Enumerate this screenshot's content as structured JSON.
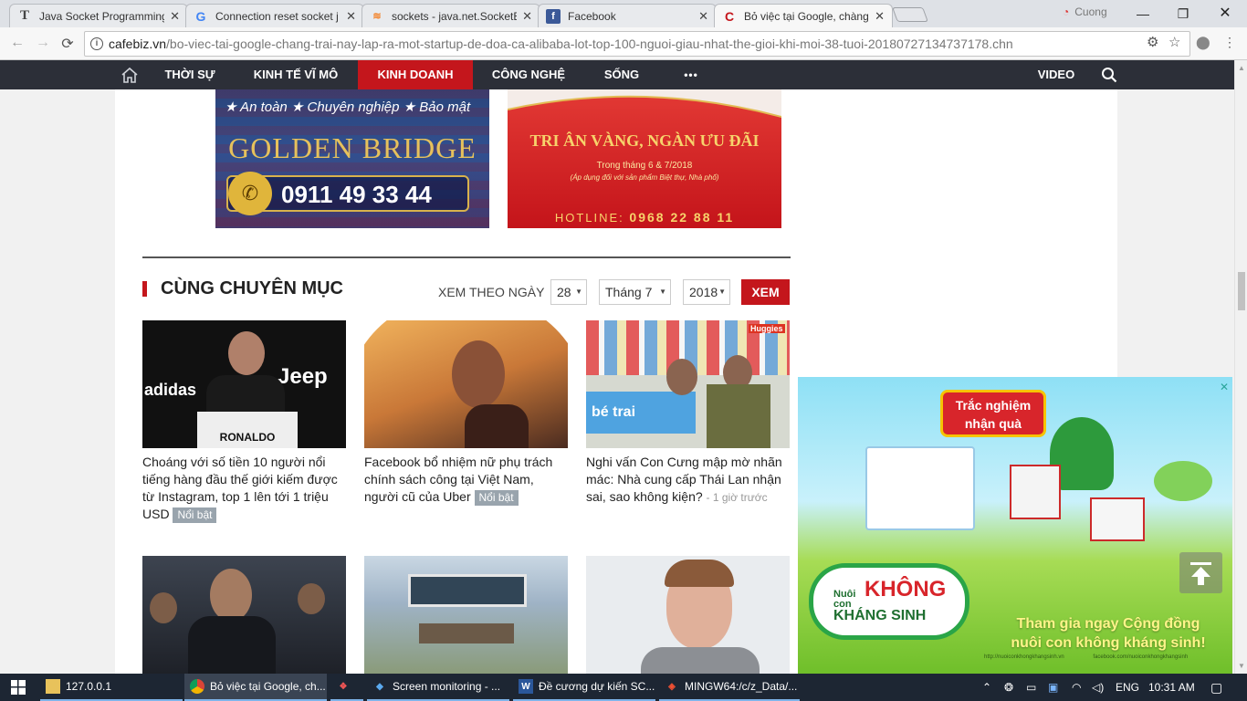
{
  "browser": {
    "tabs": [
      {
        "title": "Java Socket Programming",
        "icon": "text-T-icon"
      },
      {
        "title": "Connection reset socket j",
        "icon": "google-icon"
      },
      {
        "title": "sockets - java.net.SocketE",
        "icon": "stackoverflow-icon"
      },
      {
        "title": "Facebook",
        "icon": "facebook-icon"
      },
      {
        "title": "Bỏ việc tại Google, chàng",
        "icon": "cafebiz-icon"
      }
    ],
    "profile_name": "Cuong",
    "url_host": "cafebiz.vn",
    "url_path": "/bo-viec-tai-google-chang-trai-nay-lap-ra-mot-startup-de-doa-ca-alibaba-lot-top-100-nguoi-giau-nhat-the-gioi-khi-moi-38-tuoi-20180727134737178.chn"
  },
  "sitenav": {
    "items": [
      "THỜI SỰ",
      "KINH TẾ VĨ MÔ",
      "KINH DOANH",
      "CÔNG NGHỆ",
      "SỐNG",
      "•••"
    ],
    "active": "KINH DOANH",
    "video": "VIDEO"
  },
  "ads": {
    "golden_bridge": {
      "tagline": "★ An toàn ★ Chuyên nghiệp ★ Bảo mật",
      "brand": "GOLDEN BRIDGE",
      "phone": "0911 49 33 44"
    },
    "promo": {
      "headline": "TRI ÂN VÀNG, NGÀN ƯU ĐÃI",
      "sub": "Trong tháng 6 & 7/2018",
      "note": "(Áp dụng đối với sản phẩm Biệt thự, Nhà phố)",
      "hotline_label": "HOTLINE:",
      "hotline": "0968 22 88 11"
    },
    "floating": {
      "quiz": "Trắc nghiệm nhận quà",
      "small1": "Nuôi",
      "small2": "con",
      "big": "KHÔNG",
      "big2": "KHÁNG SINH",
      "cta_line1": "Tham gia ngay Cộng đồng",
      "cta_line2": "nuôi con không kháng sinh!",
      "link1": "http://nuoiconkhongkhangsinh.vn",
      "link2": "facebook.com/nuoiconkhongkhangsinh"
    }
  },
  "section": {
    "title": "CÙNG CHUYÊN MỤC",
    "view_by_date": "XEM THEO NGÀY",
    "day": "28",
    "month": "Tháng 7",
    "year": "2018",
    "view_button": "XEM"
  },
  "articles": [
    {
      "title": "Choáng với số tiền 10 người nổi tiếng hàng đầu thế giới kiếm được từ Instagram, top 1 lên tới 1 triệu USD",
      "badge": "Nổi bật",
      "jersey": "RONALDO",
      "brand_left": "adidas",
      "brand_right": "Jeep"
    },
    {
      "title": "Facebook bổ nhiệm nữ phụ trách chính sách công tại Việt Nam, người cũ của Uber",
      "badge": "Nổi bật"
    },
    {
      "title": "Nghi vấn Con Cưng mập mờ nhãn mác: Nhà cung cấp Thái Lan nhận sai, sao không kiện?",
      "time": "- 1 giờ trước",
      "store_sign": "bé trai",
      "store_sign2": "Huggies"
    }
  ],
  "taskbar": {
    "items": [
      {
        "label": "127.0.0.1"
      },
      {
        "label": "Bỏ việc tại Google, ch..."
      },
      {
        "label": ""
      },
      {
        "label": "Screen monitoring - ..."
      },
      {
        "label": "Đề cương dự kiến SC..."
      },
      {
        "label": "MINGW64:/c/z_Data/..."
      }
    ],
    "lang": "ENG",
    "time": "10:31 AM"
  }
}
